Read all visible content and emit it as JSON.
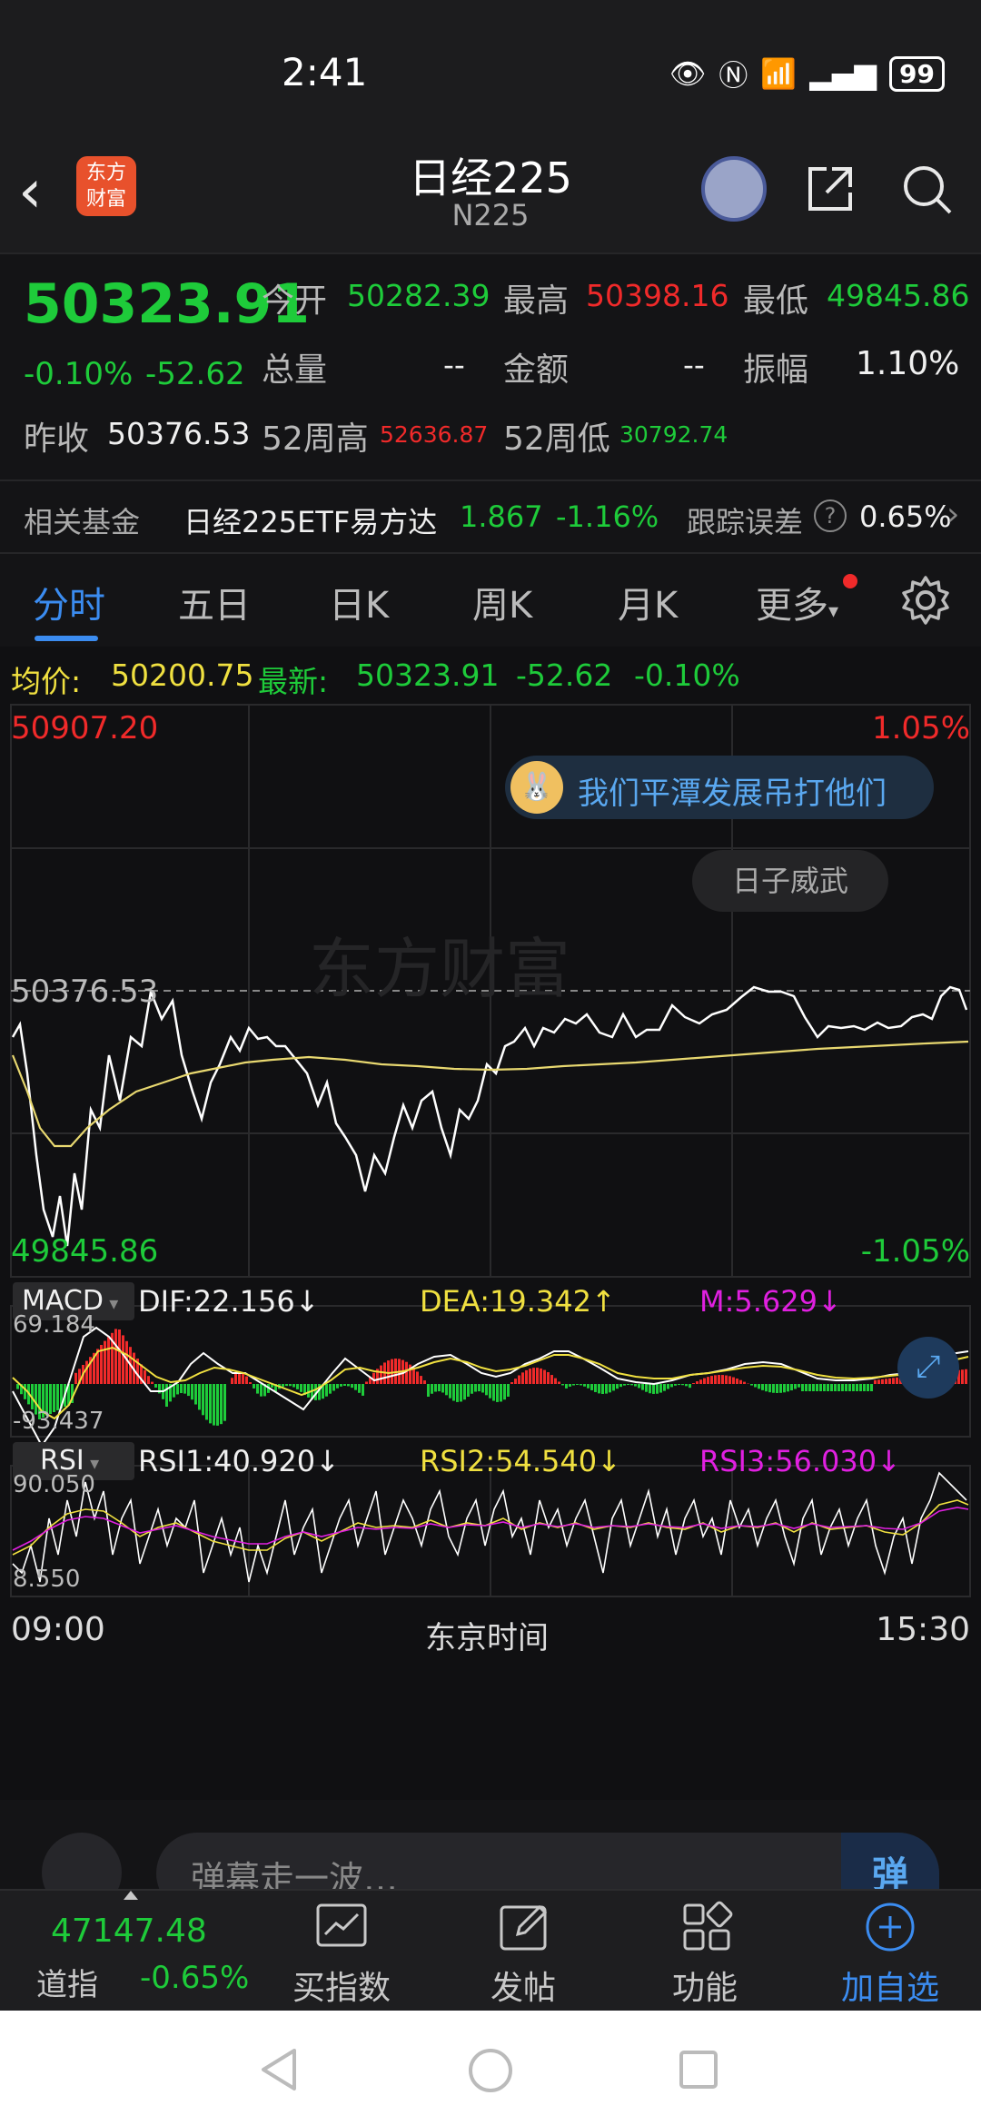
{
  "status_bar": {
    "time": "2:41",
    "battery": "99"
  },
  "header": {
    "title": "日经225",
    "code": "N225",
    "logo_text_1": "东方",
    "logo_text_2": "财富"
  },
  "quote": {
    "last_price": "50323.91",
    "change_pct": "-0.10%",
    "change": "-52.62",
    "open_label": "今开",
    "open": "50282.39",
    "high_label": "最高",
    "high": "50398.16",
    "low_label": "最低",
    "low": "49845.86",
    "volume_label": "总量",
    "volume": "--",
    "amount_label": "金额",
    "amount": "--",
    "amplitude_label": "振幅",
    "amplitude": "1.10%",
    "prev_close_label": "昨收",
    "prev_close": "50376.53",
    "wk52_high_label": "52周高",
    "wk52_high": "52636.87",
    "wk52_low_label": "52周低",
    "wk52_low": "30792.74"
  },
  "funds": {
    "label": "相关基金",
    "name": "日经225ETF易方达",
    "price": "1.867",
    "change": "-1.16%",
    "tracking_label": "跟踪误差",
    "tracking": "0.65%"
  },
  "tabs": [
    "分时",
    "五日",
    "日K",
    "周K",
    "月K",
    "更多"
  ],
  "info_line": {
    "avg_label": "均价:",
    "avg": "50200.75",
    "latest_label": "最新:",
    "latest": "50323.91",
    "change": "-52.62",
    "change_pct": "-0.10%"
  },
  "price_chart": {
    "top_price": "50907.20",
    "top_pct": "1.05%",
    "ref_price": "50376.53",
    "bottom_price": "49845.86",
    "bottom_pct": "-1.05%",
    "watermark": "东方财富"
  },
  "bubbles": {
    "comment_1": "我们平潭发展吊打他们",
    "comment_2": "日子威武"
  },
  "macd": {
    "selector": "MACD",
    "dif": "DIF:22.156↓",
    "dea": "DEA:19.342↑",
    "m": "M:5.629↓",
    "top_value": "69.184",
    "bottom_value": "-93.437"
  },
  "rsi": {
    "selector": "RSI",
    "rsi1": "RSI1:40.920↓",
    "rsi2": "RSI2:54.540↓",
    "rsi3": "RSI3:56.030↓",
    "top_value": "90.050",
    "bottom_value": "8.550"
  },
  "time_axis": {
    "start": "09:00",
    "middle": "东京时间",
    "end": "15:30"
  },
  "comment_placeholder": "弹幕走一波…",
  "bottom_nav": {
    "dow_value": "47147.48",
    "dow_label": "道指",
    "dow_change": "-0.65%",
    "items": [
      "买指数",
      "发帖",
      "功能",
      "加自选"
    ]
  },
  "colors": {
    "up": "#f02a2a",
    "down": "#1ecb3a",
    "accent": "#3b8cf0",
    "avg_line": "#e8d870",
    "price_line": "#ffffff"
  }
}
